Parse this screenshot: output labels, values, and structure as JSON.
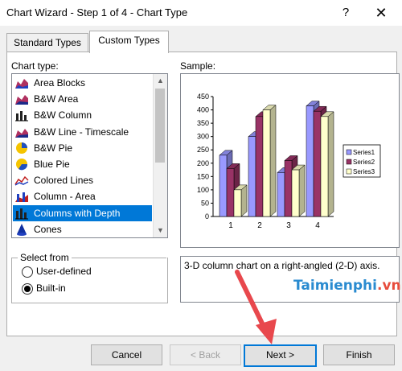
{
  "window": {
    "title": "Chart Wizard - Step 1 of 4 - Chart Type",
    "help_glyph": "?",
    "close_glyph": "✕"
  },
  "tabs": [
    "Standard Types",
    "Custom Types"
  ],
  "chart_type_label": "Chart type:",
  "chart_types": [
    {
      "label": "Area Blocks",
      "icon": "area-blocks-icon"
    },
    {
      "label": "B&W Area",
      "icon": "bw-area-icon"
    },
    {
      "label": "B&W Column",
      "icon": "bw-column-icon"
    },
    {
      "label": "B&W Line - Timescale",
      "icon": "bw-line-icon"
    },
    {
      "label": "B&W Pie",
      "icon": "bw-pie-icon"
    },
    {
      "label": "Blue Pie",
      "icon": "blue-pie-icon"
    },
    {
      "label": "Colored Lines",
      "icon": "colored-lines-icon"
    },
    {
      "label": "Column - Area",
      "icon": "column-area-icon"
    },
    {
      "label": "Columns with Depth",
      "icon": "columns-depth-icon"
    },
    {
      "label": "Cones",
      "icon": "cones-icon"
    }
  ],
  "selected_chart_type": "Columns with Depth",
  "sample_label": "Sample:",
  "description": "3-D column chart on a right-angled (2-D) axis.",
  "select_from": {
    "title": "Select from",
    "options": [
      "User-defined",
      "Built-in"
    ],
    "selected": "Built-in"
  },
  "buttons": {
    "cancel": "Cancel",
    "back": "< Back",
    "next": "Next >",
    "finish": "Finish"
  },
  "watermark": {
    "main": "Taimienphi",
    "suffix": ".vn"
  },
  "chart_data": {
    "type": "bar",
    "categories": [
      "1",
      "2",
      "3",
      "4"
    ],
    "series": [
      {
        "name": "Series1",
        "values": [
          230,
          300,
          165,
          415
        ],
        "color": "#9999ff"
      },
      {
        "name": "Series2",
        "values": [
          180,
          375,
          210,
          395
        ],
        "color": "#993366"
      },
      {
        "name": "Series3",
        "values": [
          100,
          400,
          175,
          375
        ],
        "color": "#ffffcc"
      }
    ],
    "ylim": [
      0,
      450
    ],
    "yticks": [
      0,
      50,
      100,
      150,
      200,
      250,
      300,
      350,
      400,
      450
    ],
    "legend": "right",
    "grid": false
  },
  "colors": {
    "accent": "#0078d7",
    "arrow": "#e8484d"
  }
}
